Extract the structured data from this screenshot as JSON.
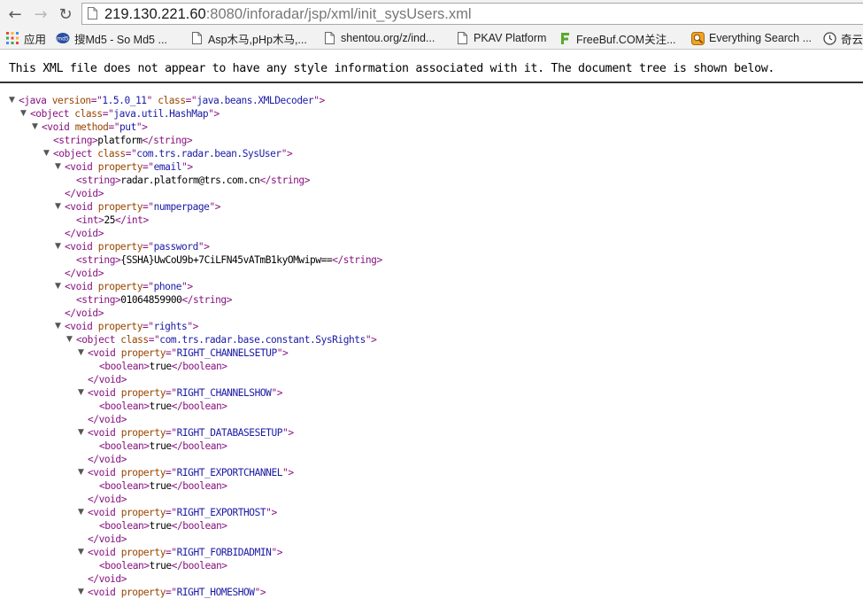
{
  "browser": {
    "url_host": "219.130.221.60",
    "url_rest": ":8080/inforadar/jsp/xml/init_sysUsers.xml"
  },
  "bookmarks": [
    {
      "label": "应用",
      "icon": "apps-grid-icon"
    },
    {
      "label": "搜Md5 - So Md5 ...",
      "icon": "somd5-logo-icon"
    },
    {
      "label": "Asp木马,pHp木马,...",
      "icon": "page-icon"
    },
    {
      "label": "shentou.org/z/ind...",
      "icon": "page-icon"
    },
    {
      "label": "PKAV Platform",
      "icon": "page-icon"
    },
    {
      "label": "FreeBuf.COM关注...",
      "icon": "freebuf-logo-icon"
    },
    {
      "label": "Everything Search ...",
      "icon": "everything-search-icon"
    },
    {
      "label": "奇云",
      "icon": "clock-icon"
    }
  ],
  "notice": "This XML file does not appear to have any style information associated with it. The document tree is shown below.",
  "xml": {
    "decl": {
      "tag": "java",
      "attrs": [
        [
          "version",
          "1.5.0_11"
        ],
        [
          "class",
          "java.beans.XMLDecoder"
        ]
      ]
    },
    "hashmap": {
      "tag": "object",
      "attrs": [
        [
          "class",
          "java.util.HashMap"
        ]
      ]
    },
    "put": {
      "tag": "void",
      "attrs": [
        [
          "method",
          "put"
        ]
      ]
    },
    "key": {
      "tag": "string",
      "text": "platform"
    },
    "sysuser": {
      "tag": "object",
      "attrs": [
        [
          "class",
          "com.trs.radar.bean.SysUser"
        ]
      ]
    },
    "props": [
      {
        "name": "email",
        "type": "string",
        "value": "radar.platform@trs.com.cn"
      },
      {
        "name": "numperpage",
        "type": "int",
        "value": "25"
      },
      {
        "name": "password",
        "type": "string",
        "value": "{SSHA}UwCoU9b+7CiLFN45vATmB1kyOMwipw=="
      },
      {
        "name": "phone",
        "type": "string",
        "value": "01064859900"
      }
    ],
    "rights_prop": {
      "tag": "void",
      "attrs": [
        [
          "property",
          "rights"
        ]
      ]
    },
    "sysrights": {
      "tag": "object",
      "attrs": [
        [
          "class",
          "com.trs.radar.base.constant.SysRights"
        ]
      ]
    },
    "rights": [
      {
        "name": "RIGHT_CHANNELSETUP",
        "type": "boolean",
        "value": "true"
      },
      {
        "name": "RIGHT_CHANNELSHOW",
        "type": "boolean",
        "value": "true"
      },
      {
        "name": "RIGHT_DATABASESETUP",
        "type": "boolean",
        "value": "true"
      },
      {
        "name": "RIGHT_EXPORTCHANNEL",
        "type": "boolean",
        "value": "true"
      },
      {
        "name": "RIGHT_EXPORTHOST",
        "type": "boolean",
        "value": "true"
      },
      {
        "name": "RIGHT_FORBIDADMIN",
        "type": "boolean",
        "value": "true"
      }
    ],
    "last_right": {
      "tag": "void",
      "attrs": [
        [
          "property",
          "RIGHT_HOMESHOW"
        ]
      ]
    }
  }
}
